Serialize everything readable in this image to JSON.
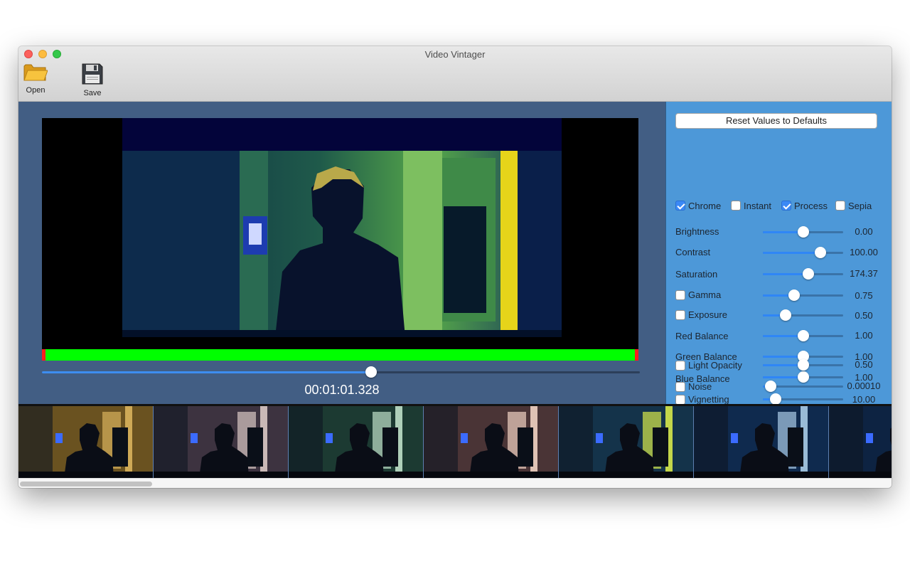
{
  "window": {
    "title": "Video Vintager"
  },
  "toolbar": {
    "open_label": "Open",
    "save_label": "Save"
  },
  "player": {
    "timecode": "00:01:01.328",
    "seek_progress": 0.551
  },
  "panel": {
    "reset_label": "Reset Values to Defaults",
    "filters": [
      {
        "label": "Chrome",
        "checked": true
      },
      {
        "label": "Instant",
        "checked": false
      },
      {
        "label": "Process",
        "checked": true
      },
      {
        "label": "Sepia",
        "checked": false
      }
    ],
    "sliders": [
      {
        "label": "Brightness",
        "value": "0.00",
        "position": 0.5,
        "has_checkbox": false
      },
      {
        "label": "Contrast",
        "value": "100.00",
        "position": 0.72,
        "has_checkbox": false
      },
      {
        "label": "Saturation",
        "value": "174.37",
        "position": 0.57,
        "has_checkbox": false
      },
      {
        "label": "Gamma",
        "value": "0.75",
        "position": 0.39,
        "has_checkbox": true
      },
      {
        "label": "Exposure",
        "value": "0.50",
        "position": 0.28,
        "has_checkbox": true
      },
      {
        "label": "Red Balance",
        "value": "1.00",
        "position": 0.5,
        "has_checkbox": false
      },
      {
        "label": "Green Balance",
        "value": "1.00",
        "position": 0.5,
        "has_checkbox": false
      },
      {
        "label": "Blue Balance",
        "value": "1.00",
        "position": 0.5,
        "has_checkbox": false
      },
      {
        "label": "Vignetting",
        "value": "10.00",
        "position": 0.16,
        "has_checkbox": true
      },
      {
        "label": "Light Opacity",
        "value": "0.50",
        "position": 0.5,
        "has_checkbox": true
      },
      {
        "label": "Noise",
        "value": "0.00010",
        "position": 0.1,
        "has_checkbox": true
      }
    ]
  },
  "thumbnails": [
    {
      "tint": "#6a5220",
      "light": "#d9b25c"
    },
    {
      "tint": "#3d3340",
      "light": "#d8c7c3"
    },
    {
      "tint": "#1c3a32",
      "light": "#bfe0c8"
    },
    {
      "tint": "#4a3436",
      "light": "#f0d2c2"
    },
    {
      "tint": "#14334a",
      "light": "#d6e84a"
    },
    {
      "tint": "#0f2a4e",
      "light": "#a9cbe6"
    },
    {
      "tint": "#0d2342",
      "light": "#9fc0e0"
    }
  ]
}
